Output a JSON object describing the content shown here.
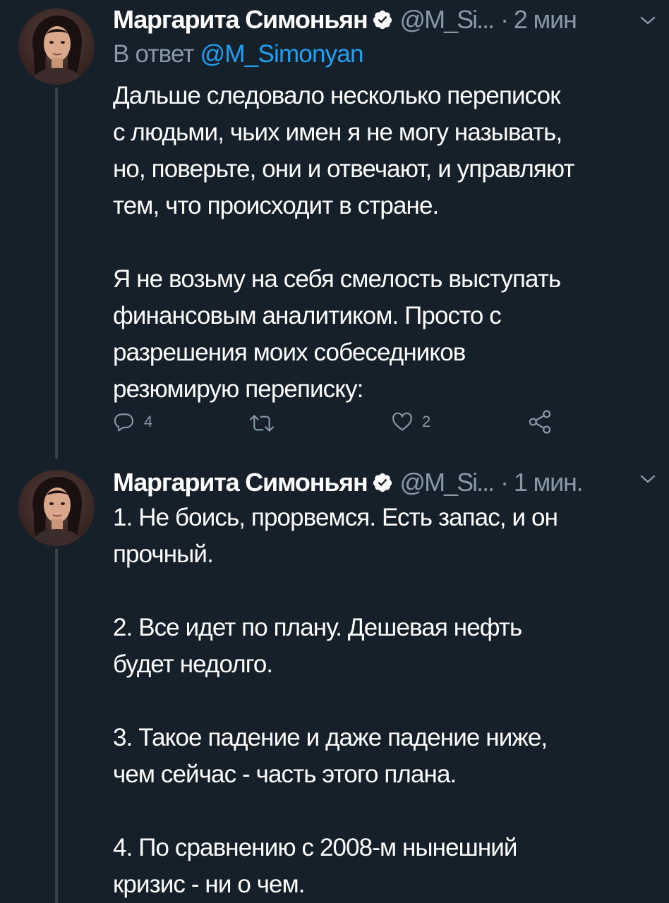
{
  "tweets": [
    {
      "author_name": "Маргарита Симоньян",
      "handle": "@M_Si...",
      "dot": "·",
      "time": "2 мин",
      "reply_prefix": "В ответ",
      "reply_mention": "@M_Simonyan",
      "paragraphs": [
        [
          "Дальше следовало несколько переписок",
          "с людьми, чьих имен я не могу называть,",
          "но, поверьте, они и отвечают, и управляют",
          "тем, что происходит в стране."
        ],
        [
          "Я не возьму на себя смелость выступать",
          "финансовым аналитиком. Просто с",
          "разрешения моих собеседников",
          "резюмирую переписку:"
        ]
      ],
      "reply_count": "4",
      "like_count": "2"
    },
    {
      "author_name": "Маргарита Симоньян",
      "handle": "@M_Si...",
      "dot": "·",
      "time": "1 мин.",
      "paragraphs": [
        [
          "1. Не боись, прорвемся. Есть запас, и он",
          "прочный."
        ],
        [
          "2. Все идет по плану. Дешевая нефть",
          "будет недолго."
        ],
        [
          "3. Такое падение и даже падение ниже,",
          "чем сейчас - часть этого плана."
        ],
        [
          "4. По сравнению с 2008-м нынешний",
          "кризис - ни о чем."
        ]
      ]
    }
  ],
  "icons": {
    "verified": "verified-badge-icon",
    "chevron": "chevron-down-icon",
    "reply": "reply-icon",
    "retweet": "retweet-icon",
    "like": "heart-icon",
    "share": "share-icon"
  },
  "colors": {
    "background": "#15202b",
    "text": "#ffffff",
    "secondary_text": "#8899a6",
    "mention": "#1da1f2",
    "thread_line": "#38444d"
  }
}
